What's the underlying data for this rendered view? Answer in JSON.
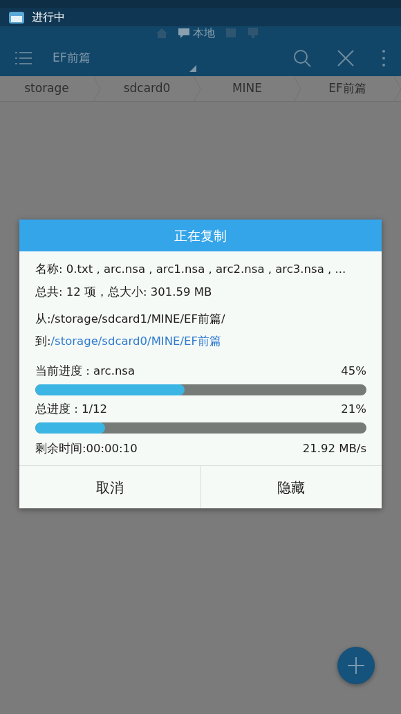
{
  "notification": {
    "text": "进行中"
  },
  "location_tabs": [
    {
      "kind": "home",
      "selected": false
    },
    {
      "kind": "local",
      "label": "本地",
      "selected": true
    },
    {
      "kind": "phone",
      "selected": false
    },
    {
      "kind": "network",
      "selected": false
    }
  ],
  "toolbar": {
    "title": "EF前篇"
  },
  "breadcrumb": [
    "storage",
    "sdcard0",
    "MINE",
    "EF前篇"
  ],
  "dialog": {
    "title": "正在复制",
    "names": "名称: 0.txt , arc.nsa , arc1.nsa , arc2.nsa , arc3.nsa , ...",
    "total": "总共: 12 项，总大小: 301.59 MB",
    "from": "从:/storage/sdcard1/MINE/EF前篇/",
    "to_label": "到:",
    "to_path": "/storage/sdcard0/MINE/EF前篇",
    "progress": [
      {
        "label": "当前进度 : arc.nsa",
        "percent": "45%",
        "level": 0.45
      },
      {
        "label": "总进度 : 1/12",
        "percent": "21%",
        "level": 0.21
      }
    ],
    "remaining": "剩余时间:00:00:10",
    "speed": "21.92 MB/s",
    "buttons": [
      "取消",
      "隐藏"
    ]
  }
}
